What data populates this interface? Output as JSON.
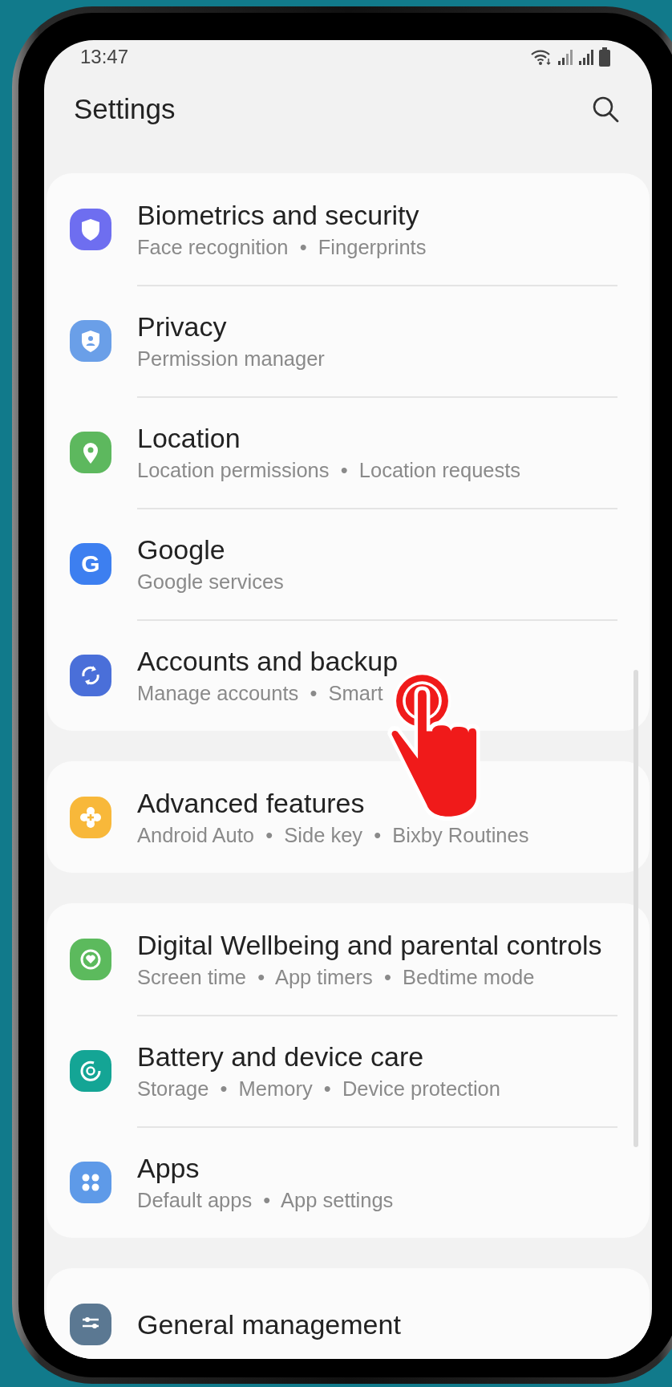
{
  "status_bar": {
    "time": "13:47"
  },
  "header": {
    "title": "Settings"
  },
  "sections": [
    {
      "items": [
        {
          "title": "Biometrics and security",
          "subtitle": "Face recognition  •  Fingerprints",
          "kind": "shield",
          "color": "#6e6ef0"
        },
        {
          "title": "Privacy",
          "subtitle": "Permission manager",
          "kind": "badge",
          "color": "#6a9fe8"
        },
        {
          "title": "Location",
          "subtitle": "Location permissions  •  Location requests",
          "kind": "pin",
          "color": "#5db85e"
        },
        {
          "title": "Google",
          "subtitle": "Google services",
          "kind": "glyph",
          "glyph": "G",
          "color": "#3d7ff0"
        },
        {
          "title": "Accounts and backup",
          "subtitle": "Manage accounts  •  Smart",
          "kind": "sync",
          "color": "#4a6fd9"
        }
      ]
    },
    {
      "items": [
        {
          "title": "Advanced features",
          "subtitle": "Android Auto  •  Side key  •  Bixby Routines",
          "kind": "plus",
          "color": "#f8b83a"
        }
      ]
    },
    {
      "items": [
        {
          "title": "Digital Wellbeing and parental controls",
          "subtitle": "Screen time  •  App timers  •  Bedtime mode",
          "kind": "heart",
          "color": "#5cba5d"
        },
        {
          "title": "Battery and device care",
          "subtitle": "Storage  •  Memory  •  Device protection",
          "kind": "ring",
          "color": "#14a595"
        },
        {
          "title": "Apps",
          "subtitle": "Default apps  •  App settings",
          "kind": "dots",
          "color": "#5e9ae8"
        }
      ]
    },
    {
      "items": [
        {
          "title": "General management",
          "kind": "sliders",
          "color": "#5b7892"
        }
      ]
    }
  ]
}
